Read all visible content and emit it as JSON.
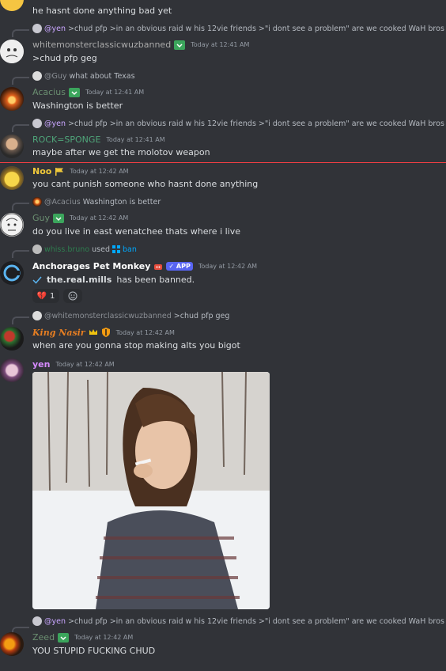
{
  "messages": {
    "m0": {
      "text": "he hasnt done anything bad yet"
    },
    "m1": {
      "reply_name": "@yen",
      "reply_text": ">chud pfp >in an obvious raid w his 12vie friends >\"i dont see a problem\"  are we cooked WaH bros",
      "author": "whitemonsterclassicwuzbanned",
      "time": "Today at 12:41 AM",
      "text": ">chud pfp geg"
    },
    "m2": {
      "reply_name": "@Guy",
      "reply_text": "what about Texas",
      "author": "Acacius",
      "time": "Today at 12:41 AM",
      "text": "Washington is better"
    },
    "m3": {
      "reply_name": "@yen",
      "reply_text": ">chud pfp >in an obvious raid w his 12vie friends >\"i dont see a problem\"  are we cooked WaH bros",
      "author": "ROCK=SPONGE",
      "time": "Today at 12:41 AM",
      "text": "maybe after we get the molotov weapon"
    },
    "m4": {
      "author": "Noo",
      "time": "Today at 12:42 AM",
      "text": "you cant punish someone who hasnt done anything"
    },
    "m5": {
      "reply_name": "@Acacius",
      "reply_text": "Washington is better",
      "author": "Guy",
      "time": "Today at 12:42 AM",
      "text": "do you live in east wenatchee thats where i live"
    },
    "m6": {
      "cmd_user": "whiss.bruno",
      "cmd_used": "used",
      "cmd_name": "ban",
      "author": "Anchorages Pet Monkey",
      "app_label": "APP",
      "time": "Today at 12:42 AM",
      "banned_user": "the.real.mills",
      "banned_suffix": "has been banned.",
      "reaction_count": "1"
    },
    "m7": {
      "reply_name": "@whitemonsterclassicwuzbanned",
      "reply_text": ">chud pfp geg",
      "author": "King Nasir",
      "time": "Today at 12:42 AM",
      "text": "when are you gonna stop making alts you bigot"
    },
    "m8": {
      "author": "yen",
      "time": "Today at 12:42 AM"
    },
    "m9": {
      "reply_name": "@yen",
      "reply_text": ">chud pfp >in an obvious raid w his 12vie friends >\"i dont see a problem\"  are we cooked WaH bros",
      "author": "Zeed",
      "time": "Today at 12:42 AM",
      "text": "YOU STUPID FUCKING CHUD"
    }
  },
  "colors": {
    "background": "#313338",
    "text": "#dbdee1",
    "timestamp": "#949ba4",
    "new_divider": "#f23f43",
    "app_badge": "#5865f2",
    "role_green": "#3ba55c",
    "yen_pink": "#d78bff",
    "noo_yellow": "#f0c93a",
    "nasir_orange": "#e67e22"
  },
  "icons": [
    "check-icon",
    "broken-heart-icon",
    "add-reaction-icon",
    "command-icon",
    "crown-icon",
    "shield-icon",
    "flag-icon",
    "heart-badge-icon"
  ]
}
